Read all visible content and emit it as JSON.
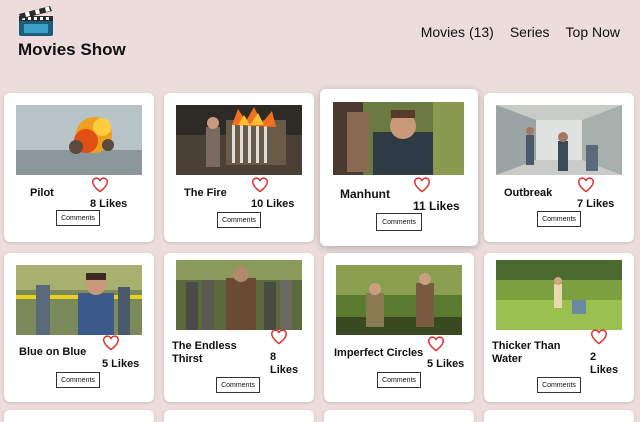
{
  "header": {
    "brand": "Movies Show",
    "nav": [
      "Movies (13)",
      "Series",
      "Top Now"
    ]
  },
  "movies": [
    {
      "title": "Pilot",
      "likes": "8 Likes",
      "button": "Comments"
    },
    {
      "title": "The Fire",
      "likes": "10 Likes",
      "button": "Comments"
    },
    {
      "title": "Manhunt",
      "likes": "11 Likes",
      "button": "Comments"
    },
    {
      "title": "Outbreak",
      "likes": "7 Likes",
      "button": "Comments"
    },
    {
      "title": "Blue on Blue",
      "likes": "5 Likes",
      "button": "Comments"
    },
    {
      "title": "The Endless Thirst",
      "likes": "8 Likes",
      "button": "Comments"
    },
    {
      "title": "Imperfect Circles",
      "likes": "5 Likes",
      "button": "Comments"
    },
    {
      "title": "Thicker Than Water",
      "likes": "2 Likes",
      "button": "Comments"
    }
  ],
  "colors": {
    "background": "#ecdcdc",
    "card": "#ffffff",
    "heart": "#e0302e"
  }
}
